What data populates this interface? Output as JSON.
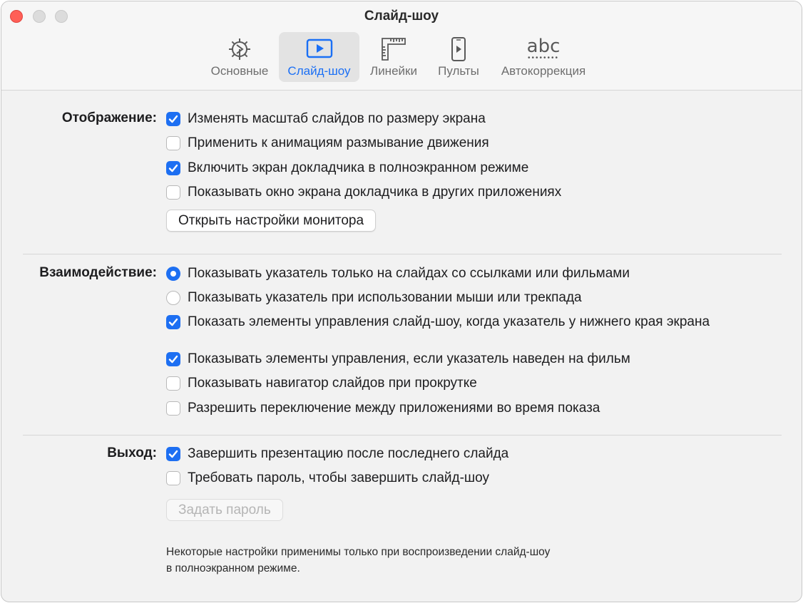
{
  "window": {
    "title": "Слайд-шоу"
  },
  "toolbar": {
    "tabs": [
      {
        "label": "Основные",
        "icon": "gear-icon",
        "active": false
      },
      {
        "label": "Слайд-шоу",
        "icon": "play-icon",
        "active": true
      },
      {
        "label": "Линейки",
        "icon": "ruler-icon",
        "active": false
      },
      {
        "label": "Пульты",
        "icon": "phone-remote-icon",
        "active": false
      },
      {
        "label": "Автокоррекция",
        "icon": "abc-icon",
        "active": false,
        "icon_text": "abc"
      }
    ]
  },
  "display": {
    "label": "Отображение:",
    "options": [
      {
        "label": "Изменять масштаб слайдов по размеру экрана",
        "checked": true
      },
      {
        "label": "Применить к анимациям размывание движения",
        "checked": false
      },
      {
        "label": "Включить экран докладчика в полноэкранном режиме",
        "checked": true
      },
      {
        "label": "Показывать окно экрана докладчика в других приложениях",
        "checked": false
      }
    ],
    "button": "Открыть настройки монитора"
  },
  "interaction": {
    "label": "Взаимодействие:",
    "radios": [
      {
        "label": "Показывать указатель только на слайдах со ссылками или фильмами",
        "selected": true
      },
      {
        "label": "Показывать указатель при использовании мыши или трекпада",
        "selected": false
      }
    ],
    "options": [
      {
        "label": "Показать элементы управления слайд-шоу, когда указатель у нижнего края экрана",
        "checked": true
      },
      {
        "label": "Показывать элементы управления, если указатель наведен на фильм",
        "checked": true
      },
      {
        "label": "Показывать навигатор слайдов при прокрутке",
        "checked": false
      },
      {
        "label": "Разрешить переключение между приложениями во время показа",
        "checked": false
      }
    ]
  },
  "exit": {
    "label": "Выход:",
    "options": [
      {
        "label": "Завершить презентацию после последнего слайда",
        "checked": true
      },
      {
        "label": "Требовать пароль, чтобы завершить слайд-шоу",
        "checked": false
      }
    ],
    "button": "Задать пароль"
  },
  "note": {
    "line1": "Некоторые настройки применимы только при воспроизведении слайд-шоу",
    "line2": "в полноэкранном режиме."
  },
  "colors": {
    "accent": "#1d6ff2",
    "close": "#ff5f57"
  }
}
